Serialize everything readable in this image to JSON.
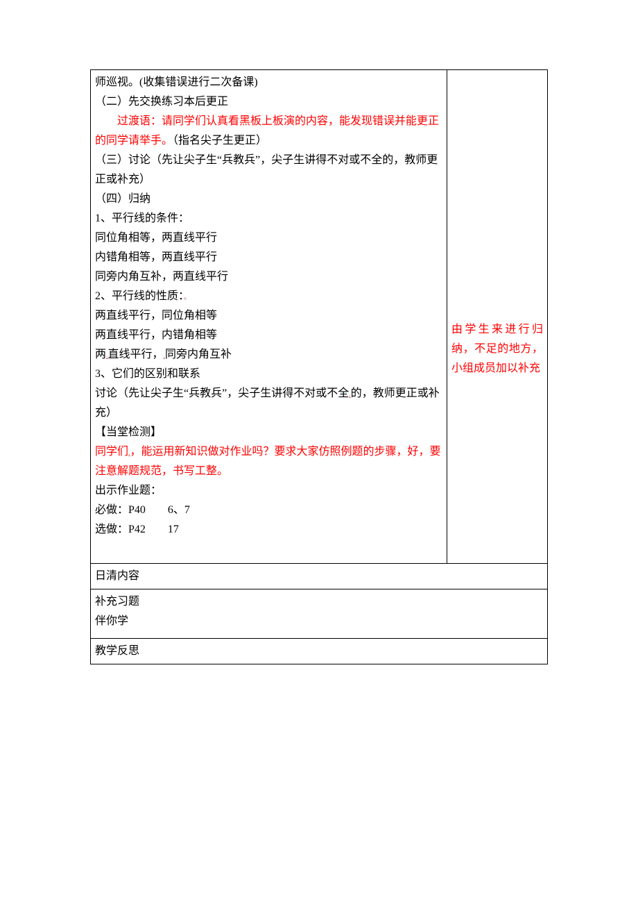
{
  "main": {
    "p1": "师巡视。(收集错误进行二次备课)",
    "p2": "（二）先交换练习本后更正",
    "p3_pre": "　　",
    "p3_red_a": "过渡语：请同学们认真看黑板上板演的内容，能发现错误并能更正的同学请举手。",
    "p3_black": "（指名尖子生更正）",
    "p4": "（三）讨论（先让尖子生“兵教兵”，尖子生讲得不对或不全的，教师更正或补充）",
    "p5": "（四）归纳",
    "p6": "1、平行线的条件：",
    "p7": "同位角相等，两直线平行",
    "p8": "内错角相等，两直线平行",
    "p9": "同旁内角互补，两直线平行",
    "p10a": "2、平行线的性质：",
    "p11": "两直线平行，同位角相等",
    "p12": "两直线平行，内错角相等",
    "p13a": "两",
    "p13b": "直线平行，",
    "p13c": "同旁内角互补",
    "p14": "3、它们的区别和联系",
    "p15a": "讨论（先让尖子生“兵教兵”，尖子生讲得不对或不全",
    "p15b": "的，教师更正或补充）",
    "p16": "【当堂检测】",
    "p17a": "同学们",
    "p17b": "，能运用新知识做对作业吗？要求大家仿照例题的步骤，好，要注意解题规范，书写工整。",
    "p18": "出示作业题：",
    "p19": "必做：P40　　6、7",
    "p20": "选做：P42　　17"
  },
  "side": "由学生来进行归纳，不足的地方，小组成员加以补充",
  "row2_label": "日清内容",
  "row3a": "补充习题",
  "row3b": "伴你学",
  "row4_label": "教学反思"
}
